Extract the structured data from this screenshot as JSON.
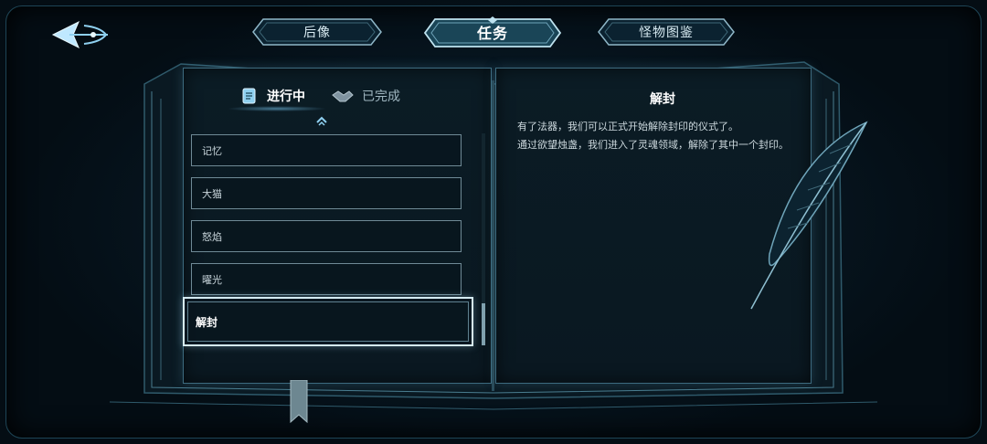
{
  "top_tabs": [
    {
      "label": "后像",
      "active": false
    },
    {
      "label": "任务",
      "active": true
    },
    {
      "label": "怪物图鉴",
      "active": false
    }
  ],
  "status_tabs": {
    "in_progress": {
      "label": "进行中",
      "icon": "scroll-icon",
      "active": true
    },
    "completed": {
      "label": "已完成",
      "icon": "handshake-icon",
      "active": false
    }
  },
  "quests": [
    "记忆",
    "大猫",
    "怒焰",
    "曜光",
    "解封"
  ],
  "selected_quest": "解封",
  "detail": {
    "title": "解封",
    "lines": [
      "有了法器，我们可以正式开始解除封印的仪式了。",
      "通过欲望烛盏，我们进入了灵魂领域，解除了其中一个封印。"
    ]
  },
  "colors": {
    "background": "#05111a",
    "accent": "#8fd0f0",
    "page": "#0b1c25",
    "border": "#3d6b7f"
  }
}
